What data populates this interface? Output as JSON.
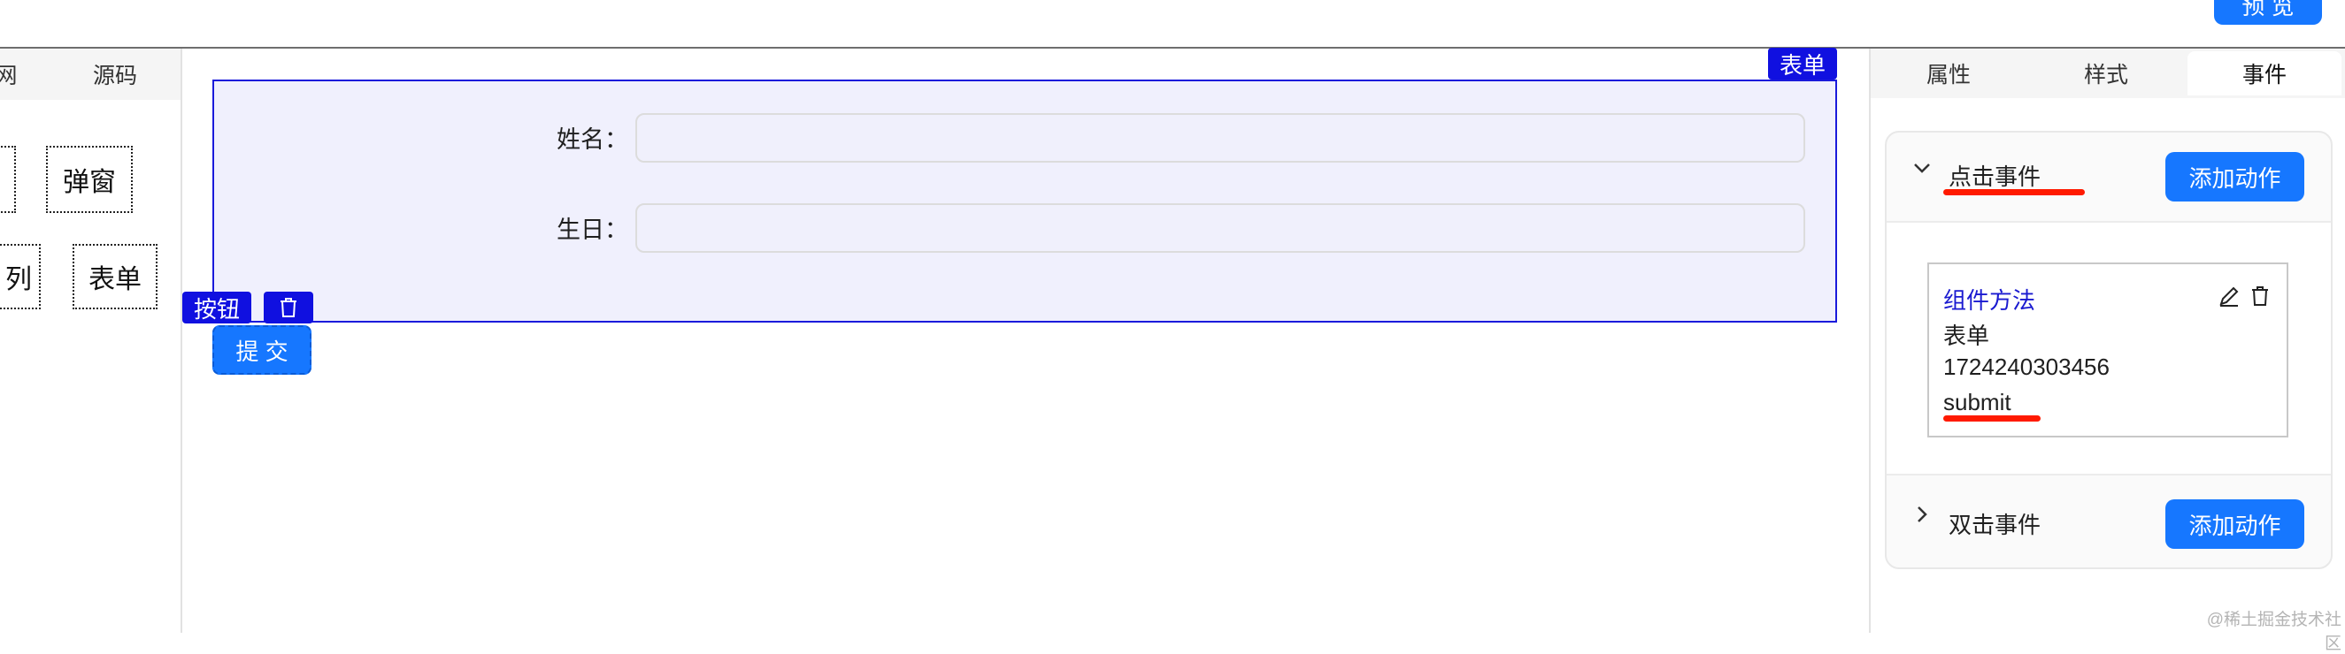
{
  "toolbar": {
    "preview_label": "预 览"
  },
  "left_panel": {
    "tabs": [
      "网",
      "源码"
    ],
    "components": [
      "弹窗",
      "列",
      "表单"
    ]
  },
  "canvas": {
    "form_tag": "表单",
    "fields": [
      {
        "label": "姓名：",
        "value": ""
      },
      {
        "label": "生日：",
        "value": ""
      }
    ],
    "button_tag": "按钮",
    "submit_label": "提 交"
  },
  "right_panel": {
    "tabs": [
      "属性",
      "样式",
      "事件"
    ],
    "active_tab": "事件",
    "events": [
      {
        "name": "点击事件",
        "expanded": true,
        "add_label": "添加动作",
        "action": {
          "type": "组件方法",
          "component": "表单",
          "id": "1724240303456",
          "method": "submit"
        }
      },
      {
        "name": "双击事件",
        "expanded": false,
        "add_label": "添加动作"
      }
    ]
  },
  "watermark": "@稀土掘金技术社区",
  "colors": {
    "primary": "#1677ff",
    "selection": "#1010e0",
    "highlight": "#ff1a00"
  }
}
